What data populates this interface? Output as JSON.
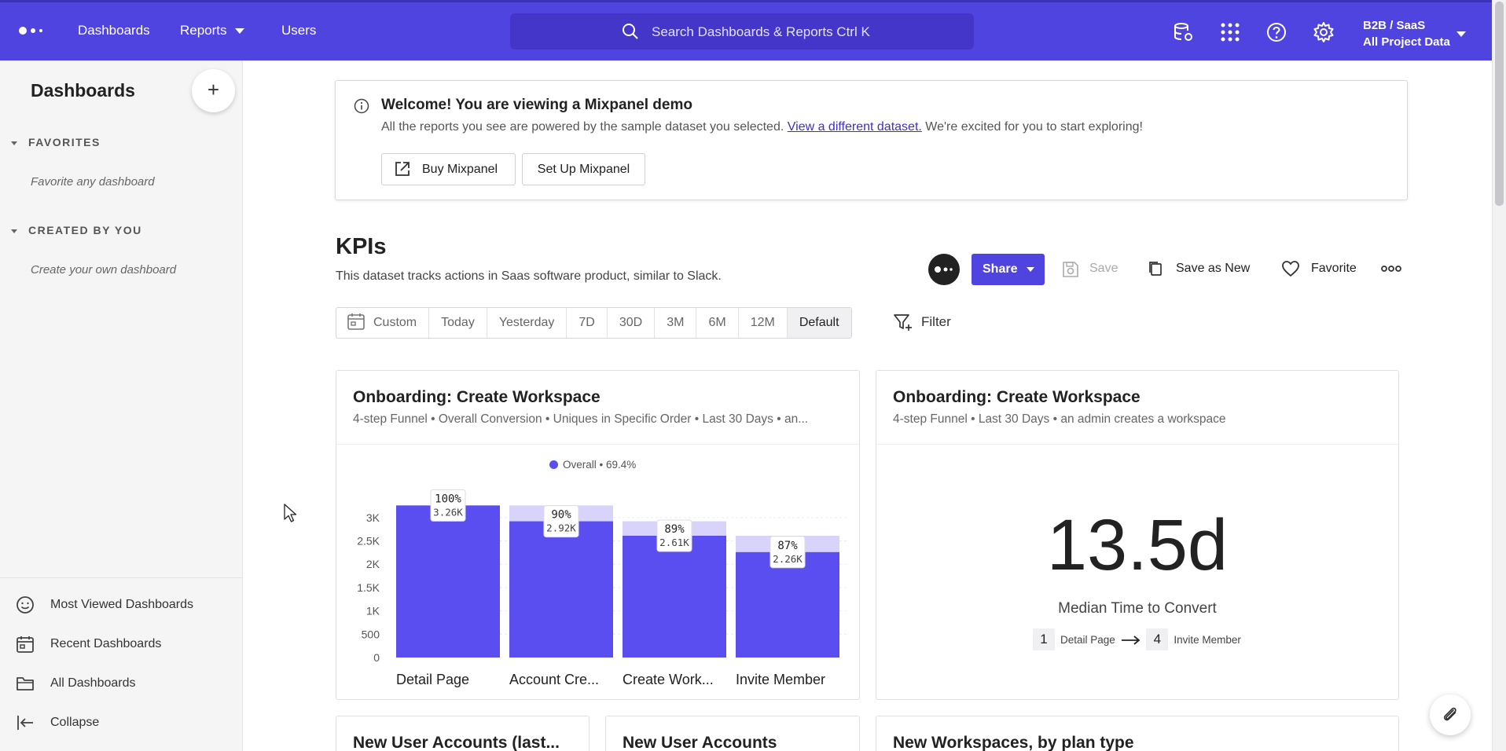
{
  "topbar": {
    "nav": [
      {
        "label": "Dashboards"
      },
      {
        "label": "Reports",
        "dropdown": true
      },
      {
        "label": "Users"
      }
    ],
    "search_placeholder": "Search Dashboards & Reports Ctrl K",
    "icons": [
      "database-gear-icon",
      "apps-grid-icon",
      "help-icon",
      "settings-gear-icon"
    ],
    "project_name": "B2B / SaaS",
    "project_data": "All Project Data",
    "brand_color": "#4f44e0"
  },
  "sidebar": {
    "title": "Dashboards",
    "add_label": "+",
    "sections": [
      {
        "label": "FAVORITES",
        "hint": "Favorite any dashboard"
      },
      {
        "label": "CREATED BY YOU",
        "hint": "Create your own dashboard"
      }
    ],
    "links": [
      {
        "label": "Most Viewed Dashboards",
        "icon": "smiley-icon"
      },
      {
        "label": "Recent Dashboards",
        "icon": "calendar-icon"
      },
      {
        "label": "All Dashboards",
        "icon": "folder-icon"
      },
      {
        "label": "Collapse",
        "icon": "collapse-arrow-icon"
      }
    ]
  },
  "welcome": {
    "title": "Welcome! You are viewing a Mixpanel demo",
    "text_before": "All the reports you see are powered by the sample dataset you selected. ",
    "link": "View a different dataset.",
    "text_after": " We're excited for you to start exploring!",
    "buy_label": "Buy Mixpanel",
    "setup_label": "Set Up Mixpanel"
  },
  "dashboard": {
    "title": "KPIs",
    "description": "This dataset tracks actions in Saas software product, similar to Slack.",
    "share_label": "Share",
    "save_label": "Save",
    "save_new_label": "Save as New",
    "favorite_label": "Favorite",
    "date_ranges": [
      "Custom",
      "Today",
      "Yesterday",
      "7D",
      "30D",
      "3M",
      "6M",
      "12M",
      "Default"
    ],
    "active_range": "Default",
    "filter_label": "Filter"
  },
  "cards": {
    "funnel": {
      "title": "Onboarding: Create Workspace",
      "subtitle": "4-step Funnel • Overall Conversion • Uniques in Specific Order • Last 30 Days • an..."
    },
    "median": {
      "title": "Onboarding: Create Workspace",
      "subtitle": "4-step Funnel • Last 30 Days • an admin creates a workspace",
      "value": "13.5d",
      "label": "Median Time to Convert",
      "from_step": "1",
      "from_label": "Detail Page",
      "to_step": "4",
      "to_label": "Invite Member"
    },
    "bottom": [
      {
        "title": "New User Accounts (last..."
      },
      {
        "title": "New User Accounts"
      },
      {
        "title": "New Workspaces, by plan type"
      }
    ]
  },
  "chart_data": {
    "type": "bar",
    "legend": "Overall • 69.4%",
    "categories": [
      "Detail Page",
      "Account Cre...",
      "Create Work...",
      "Invite Member"
    ],
    "values": [
      3260,
      2920,
      2610,
      2260
    ],
    "previous_step_values": [
      3260,
      3260,
      2920,
      2610
    ],
    "percent_labels": [
      "100%",
      "90%",
      "89%",
      "87%"
    ],
    "value_labels": [
      "3.26K",
      "2.92K",
      "2.61K",
      "2.26K"
    ],
    "y_ticks": [
      "0",
      "500",
      "1K",
      "1.5K",
      "2K",
      "2.5K",
      "3K"
    ],
    "y_tick_values": [
      0,
      500,
      1000,
      1500,
      2000,
      2500,
      3000
    ],
    "ylim": [
      0,
      3300
    ],
    "bar_color": "#5b4ef0",
    "dropoff_color": "#d7d3fb"
  }
}
